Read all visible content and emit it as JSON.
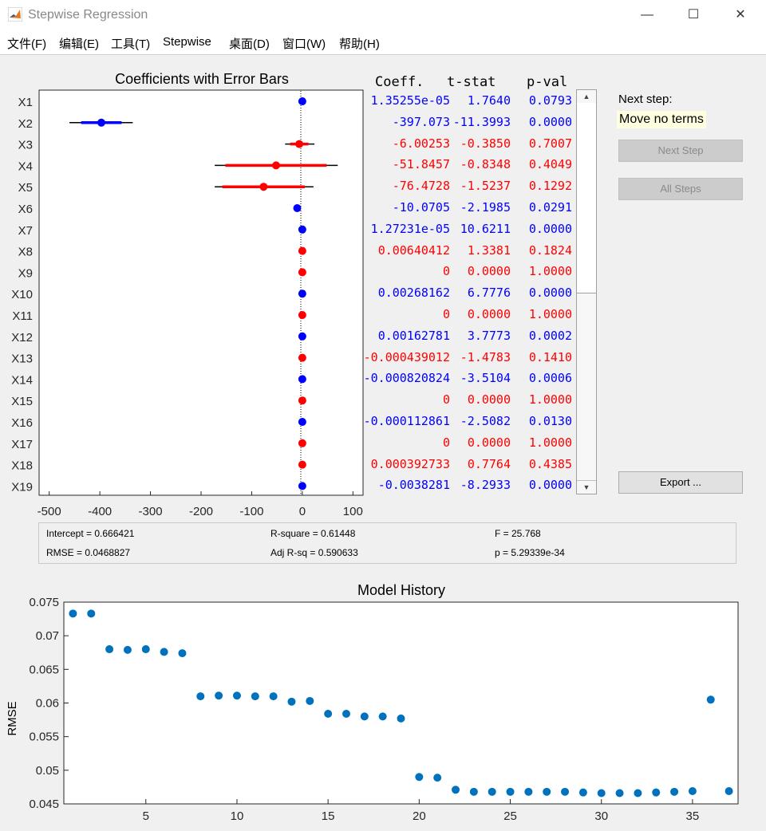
{
  "window": {
    "title": "Stepwise Regression",
    "minimize": "—",
    "maximize": "☐",
    "close": "✕"
  },
  "menu": [
    "文件(F)",
    "编辑(E)",
    "工具(T)",
    "Stepwise",
    "桌面(D)",
    "窗口(W)",
    "帮助(H)"
  ],
  "coef_header": {
    "coeff": "Coeff.",
    "tstat": "t-stat",
    "pval": "p-val"
  },
  "next_step": {
    "label": "Next step:",
    "value": "Move no terms"
  },
  "buttons": {
    "next_step": "Next Step",
    "all_steps": "All Steps",
    "export": "Export ..."
  },
  "colors": {
    "in_model": "#0000ff",
    "out_model": "#ff0000",
    "history_marker": "#0072bd",
    "next_step_bg": "#ffffe0"
  },
  "rows": [
    {
      "name": "X1",
      "coeff": "1.35255e-05",
      "tstat": "1.7640",
      "pval": "0.0793",
      "in": true,
      "est": 0,
      "lo": 0,
      "hi": 0,
      "tlo": 0,
      "thi": 0
    },
    {
      "name": "X2",
      "coeff": "-397.073",
      "tstat": "-11.3993",
      "pval": "0.0000",
      "in": true,
      "est": -397.073,
      "lo": -437,
      "hi": -357,
      "tlo": -460,
      "thi": -335
    },
    {
      "name": "X3",
      "coeff": "-6.00253",
      "tstat": "-0.3850",
      "pval": "0.7007",
      "in": false,
      "est": -6.00253,
      "lo": -24,
      "hi": 12,
      "tlo": -34,
      "thi": 24
    },
    {
      "name": "X4",
      "coeff": "-51.8457",
      "tstat": "-0.8348",
      "pval": "0.4049",
      "in": false,
      "est": -51.8457,
      "lo": -152,
      "hi": 48,
      "tlo": -173,
      "thi": 70
    },
    {
      "name": "X5",
      "coeff": "-76.4728",
      "tstat": "-1.5237",
      "pval": "0.1292",
      "in": false,
      "est": -76.4728,
      "lo": -158,
      "hi": 5,
      "tlo": -173,
      "thi": 22
    },
    {
      "name": "X6",
      "coeff": "-10.0705",
      "tstat": "-2.1985",
      "pval": "0.0291",
      "in": true,
      "est": -10.0705,
      "lo": -14,
      "hi": -6,
      "tlo": -16,
      "thi": -4
    },
    {
      "name": "X7",
      "coeff": "1.27231e-05",
      "tstat": "10.6211",
      "pval": "0.0000",
      "in": true,
      "est": 0,
      "lo": 0,
      "hi": 0,
      "tlo": 0,
      "thi": 0
    },
    {
      "name": "X8",
      "coeff": "0.00640412",
      "tstat": "1.3381",
      "pval": "0.1824",
      "in": false,
      "est": 0.00640412,
      "lo": 0,
      "hi": 0,
      "tlo": 0,
      "thi": 0
    },
    {
      "name": "X9",
      "coeff": "0",
      "tstat": "0.0000",
      "pval": "1.0000",
      "in": false,
      "est": 0,
      "lo": 0,
      "hi": 0,
      "tlo": 0,
      "thi": 0
    },
    {
      "name": "X10",
      "coeff": "0.00268162",
      "tstat": "6.7776",
      "pval": "0.0000",
      "in": true,
      "est": 0.00268162,
      "lo": 0,
      "hi": 0,
      "tlo": 0,
      "thi": 0
    },
    {
      "name": "X11",
      "coeff": "0",
      "tstat": "0.0000",
      "pval": "1.0000",
      "in": false,
      "est": 0,
      "lo": 0,
      "hi": 0,
      "tlo": 0,
      "thi": 0
    },
    {
      "name": "X12",
      "coeff": "0.00162781",
      "tstat": "3.7773",
      "pval": "0.0002",
      "in": true,
      "est": 0.00162781,
      "lo": 0,
      "hi": 0,
      "tlo": 0,
      "thi": 0
    },
    {
      "name": "X13",
      "coeff": "-0.000439012",
      "tstat": "-1.4783",
      "pval": "0.1410",
      "in": false,
      "est": -0.000439012,
      "lo": 0,
      "hi": 0,
      "tlo": 0,
      "thi": 0
    },
    {
      "name": "X14",
      "coeff": "-0.000820824",
      "tstat": "-3.5104",
      "pval": "0.0006",
      "in": true,
      "est": -0.000820824,
      "lo": 0,
      "hi": 0,
      "tlo": 0,
      "thi": 0
    },
    {
      "name": "X15",
      "coeff": "0",
      "tstat": "0.0000",
      "pval": "1.0000",
      "in": false,
      "est": 0,
      "lo": 0,
      "hi": 0,
      "tlo": 0,
      "thi": 0
    },
    {
      "name": "X16",
      "coeff": "-0.000112861",
      "tstat": "-2.5082",
      "pval": "0.0130",
      "in": true,
      "est": -0.000112861,
      "lo": 0,
      "hi": 0,
      "tlo": 0,
      "thi": 0
    },
    {
      "name": "X17",
      "coeff": "0",
      "tstat": "0.0000",
      "pval": "1.0000",
      "in": false,
      "est": 0,
      "lo": 0,
      "hi": 0,
      "tlo": 0,
      "thi": 0
    },
    {
      "name": "X18",
      "coeff": "0.000392733",
      "tstat": "0.7764",
      "pval": "0.4385",
      "in": false,
      "est": 0.000392733,
      "lo": 0,
      "hi": 0,
      "tlo": 0,
      "thi": 0
    },
    {
      "name": "X19",
      "coeff": "-0.0038281",
      "tstat": "-8.2933",
      "pval": "0.0000",
      "in": true,
      "est": -0.0038281,
      "lo": 0,
      "hi": 0,
      "tlo": 0,
      "thi": 0
    }
  ],
  "stats": {
    "intercept": "Intercept = 0.666421",
    "rmse": "RMSE = 0.0468827",
    "rsquare": "R-square = 0.61448",
    "adjrsq": "Adj R-sq = 0.590633",
    "f": "F = 25.768",
    "p": "p = 5.29339e-34"
  },
  "chart_data": [
    {
      "type": "scatter",
      "title": "Coefficients with Error Bars",
      "xlim": [
        -520,
        120
      ],
      "xticks": [
        "-500",
        "-400",
        "-300",
        "-200",
        "-100",
        "0",
        "100"
      ],
      "xtick_values": [
        -500,
        -400,
        -300,
        -200,
        -100,
        0,
        100
      ],
      "note": "one row per term X1–X19; blue = in model, red = out of model"
    },
    {
      "type": "scatter",
      "title": "Model History",
      "xlabel": "",
      "ylabel": "RMSE",
      "xlim": [
        0.5,
        37.5
      ],
      "ylim": [
        0.045,
        0.075
      ],
      "xticks": [
        "5",
        "10",
        "15",
        "20",
        "25",
        "30",
        "35"
      ],
      "xtick_values": [
        5,
        10,
        15,
        20,
        25,
        30,
        35
      ],
      "yticks": [
        "0.045",
        "0.05",
        "0.055",
        "0.06",
        "0.065",
        "0.07",
        "0.075"
      ],
      "ytick_values": [
        0.045,
        0.05,
        0.055,
        0.06,
        0.065,
        0.07,
        0.075
      ],
      "x": [
        1,
        2,
        3,
        4,
        5,
        6,
        7,
        8,
        9,
        10,
        11,
        12,
        13,
        14,
        15,
        16,
        17,
        18,
        19,
        20,
        21,
        22,
        23,
        24,
        25,
        26,
        27,
        28,
        29,
        30,
        31,
        32,
        33,
        34,
        35,
        36,
        37
      ],
      "y": [
        0.0733,
        0.0733,
        0.068,
        0.0679,
        0.068,
        0.0676,
        0.0674,
        0.061,
        0.0611,
        0.0611,
        0.061,
        0.061,
        0.0602,
        0.0603,
        0.0584,
        0.0584,
        0.058,
        0.058,
        0.0577,
        0.049,
        0.0489,
        0.0471,
        0.0468,
        0.0468,
        0.0468,
        0.0468,
        0.0468,
        0.0468,
        0.0467,
        0.0466,
        0.0466,
        0.0466,
        0.0467,
        0.0468,
        0.0469,
        0.0605,
        0.0469
      ]
    }
  ]
}
